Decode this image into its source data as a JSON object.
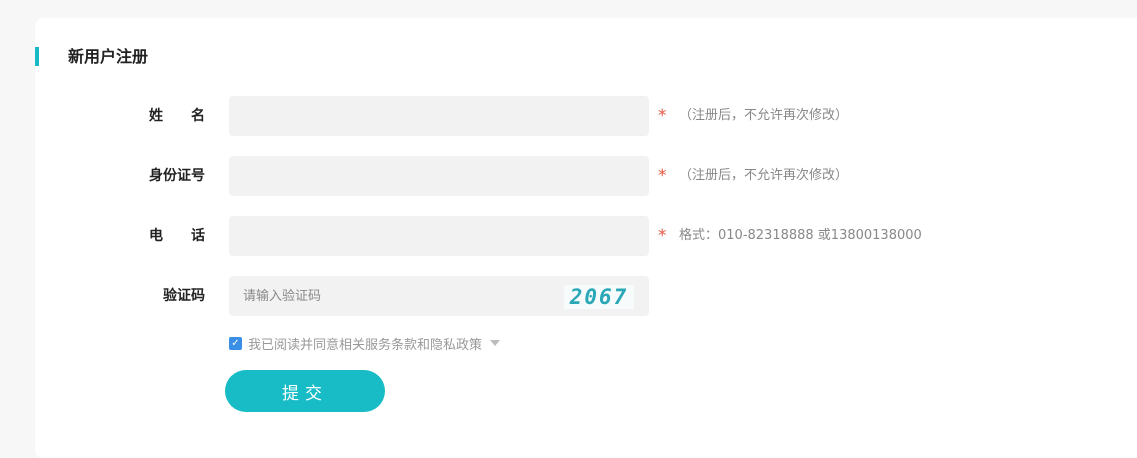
{
  "form": {
    "title": "新用户注册",
    "fields": [
      {
        "label": "姓名",
        "value": "",
        "required_mark": "*",
        "hint": "（注册后，不允许再次修改）"
      },
      {
        "label": "身份证号",
        "value": "",
        "required_mark": "*",
        "hint": "（注册后，不允许再次修改）"
      },
      {
        "label": "电话",
        "value": "",
        "required_mark": "*",
        "hint": "格式：010-82318888 或13800138000"
      },
      {
        "label": "验证码",
        "value": "",
        "placeholder": "请输入验证码",
        "captcha_text": "2067"
      }
    ],
    "agreement": {
      "checked": true,
      "text": "我已阅读并同意相关服务条款和隐私政策"
    },
    "submit_label": "提交"
  },
  "colors": {
    "accent": "#17bcc6",
    "required": "#e8533f",
    "checkbox": "#3a8ee6"
  }
}
